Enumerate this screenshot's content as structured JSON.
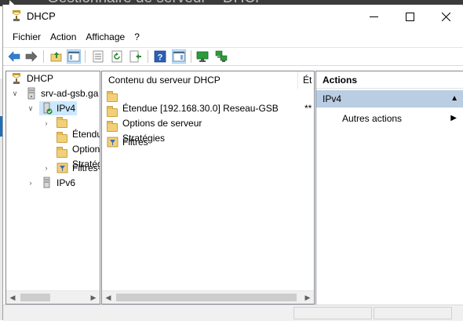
{
  "background": {
    "title": "Gestionnaire de serveur – DHCP"
  },
  "window": {
    "title": "DHCP",
    "minimize": "—",
    "maximize": "☐",
    "close": "✕"
  },
  "menu": [
    {
      "label": "Fichier"
    },
    {
      "label": "Action"
    },
    {
      "label": "Affichage"
    },
    {
      "label": "?"
    }
  ],
  "tree": {
    "root": "DHCP",
    "server": "srv-ad-gsb.ga",
    "ipv4": "IPv4",
    "ipv4_children": [
      {
        "label": "Étendu"
      },
      {
        "label": "Option"
      },
      {
        "label": "Stratég"
      },
      {
        "label": "Filtres"
      }
    ],
    "ipv6": "IPv6"
  },
  "content": {
    "columns": [
      "Contenu du serveur DHCP",
      "Ét"
    ],
    "rows": [
      {
        "name": "Étendue [192.168.30.0] Reseau-GSB",
        "status": "**"
      },
      {
        "name": "Options de serveur",
        "status": ""
      },
      {
        "name": "Stratégies",
        "status": ""
      },
      {
        "name": "Filtres",
        "status": ""
      }
    ]
  },
  "actions": {
    "title": "Actions",
    "section": "IPv4",
    "items": [
      {
        "label": "Autres actions"
      }
    ]
  },
  "colors": {
    "selection": "#cce8ff",
    "action_section": "#b9cde3",
    "folder": "#f2d07a"
  }
}
